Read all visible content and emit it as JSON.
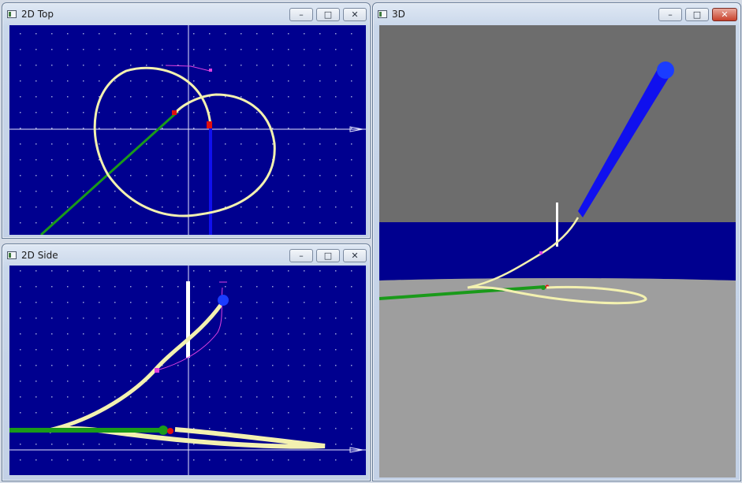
{
  "windows": {
    "top": {
      "title": "2D Top",
      "minimize": "–",
      "maximize": "□",
      "close": "✕"
    },
    "side": {
      "title": "2D Side",
      "minimize": "–",
      "maximize": "□",
      "close": "✕"
    },
    "view3d": {
      "title": "3D",
      "minimize": "–",
      "maximize": "□",
      "close": "✕"
    }
  },
  "icons": {
    "app": "window-app-icon",
    "minimize": "minimize-icon",
    "maximize": "maximize-icon",
    "close": "close-icon"
  },
  "colors": {
    "plot_background": "#00008f",
    "curve": "#f3f1b0",
    "green_line": "#1a9a1a",
    "blue_pole": "#1010ee",
    "red_marker": "#e01010",
    "magenta_marker": "#e040e0",
    "sky_3d": "#6d6d6d",
    "ground_3d": "#9e9e9e",
    "band_3d": "#00008f"
  }
}
